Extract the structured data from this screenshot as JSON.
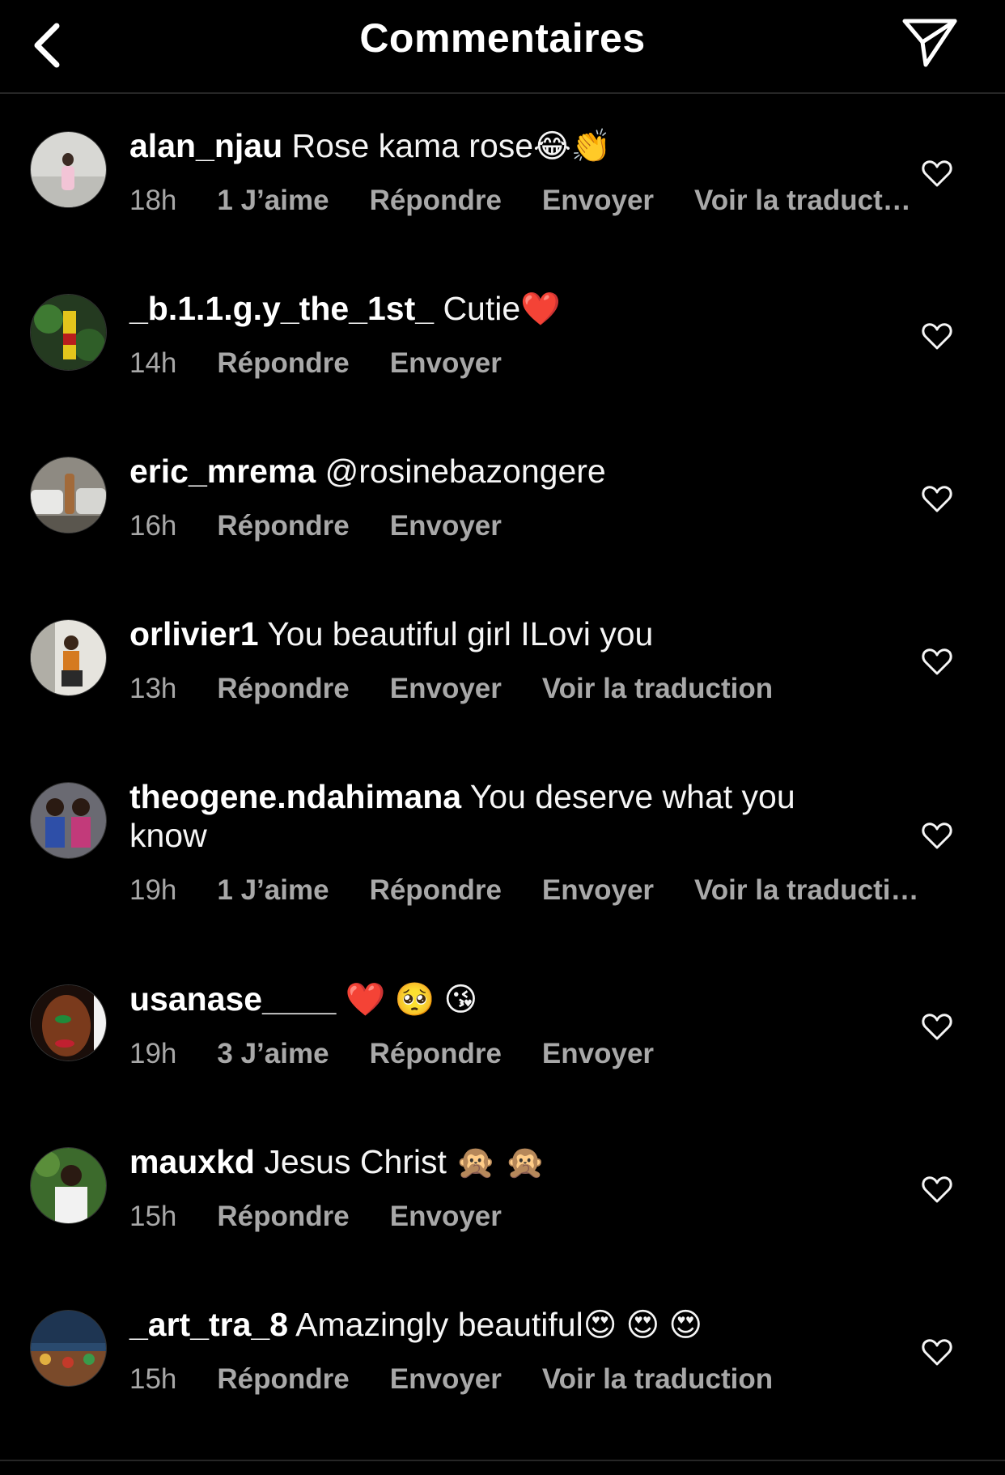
{
  "header": {
    "title": "Commentaires",
    "back_icon": "chevron-left-icon",
    "send_icon": "paper-plane-icon"
  },
  "colors": {
    "background": "#000000",
    "text": "#f5f5f5",
    "muted": "#a8a8a8",
    "divider": "#262626"
  },
  "comments": [
    {
      "username": "alan_njau",
      "text": "Rose kama rose",
      "emoji": "😂👏",
      "time": "18h",
      "likes": "1 J’aime",
      "reply": "Répondre",
      "send": "Envoyer",
      "translate": "Voir la traduct…"
    },
    {
      "username": "_b.1.1.g.y_the_1st_",
      "text": "Cutie",
      "emoji": "❤️",
      "time": "14h",
      "likes": "",
      "reply": "Répondre",
      "send": "Envoyer",
      "translate": ""
    },
    {
      "username": "eric_mrema",
      "text": "@rosinebazongere",
      "emoji": "",
      "time": "16h",
      "likes": "",
      "reply": "Répondre",
      "send": "Envoyer",
      "translate": ""
    },
    {
      "username": "orlivier1",
      "text": "You beautiful girl ILovi you",
      "emoji": "",
      "time": "13h",
      "likes": "",
      "reply": "Répondre",
      "send": "Envoyer",
      "translate": "Voir la traduction"
    },
    {
      "username": "theogene.ndahimana",
      "text": "You deserve what you know",
      "emoji": "",
      "time": "19h",
      "likes": "1 J’aime",
      "reply": "Répondre",
      "send": "Envoyer",
      "translate": "Voir la traducti…"
    },
    {
      "username": "usanase____",
      "text": "",
      "emoji": "❤️ 🥺 😘",
      "time": "19h",
      "likes": "3 J’aime",
      "reply": "Répondre",
      "send": "Envoyer",
      "translate": ""
    },
    {
      "username": "mauxkd",
      "text": "Jesus Christ",
      "emoji": "🙊 🙊",
      "time": "15h",
      "likes": "",
      "reply": "Répondre",
      "send": "Envoyer",
      "translate": ""
    },
    {
      "username": "_art_tra_8",
      "text": "Amazingly beautiful",
      "emoji": "😍 😍 😍",
      "time": "15h",
      "likes": "",
      "reply": "Répondre",
      "send": "Envoyer",
      "translate": "Voir la traduction"
    }
  ]
}
